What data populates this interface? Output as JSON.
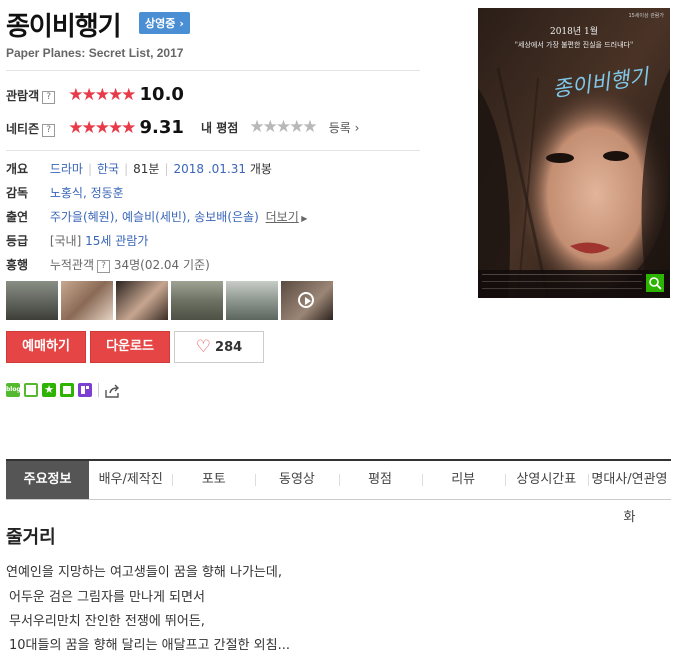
{
  "movie": {
    "title": "종이비행기",
    "status_badge": "상영중",
    "subtitle": "Paper Planes: Secret List, 2017"
  },
  "ratings": {
    "audience_label": "관람객",
    "audience_score": "10.0",
    "audience_stars": "★★★★★",
    "netizen_label": "네티즌",
    "netizen_score": "9.31",
    "netizen_stars": "★★★★★",
    "my_rating_label": "내 평점",
    "my_rating_stars": "★★★★★",
    "register_label": "등록"
  },
  "info": {
    "overview_label": "개요",
    "genre": "드라마",
    "country": "한국",
    "runtime": "81분",
    "release_date": "2018 .01.31",
    "release_suffix": "개봉",
    "director_label": "감독",
    "directors": "노홍식, 정동훈",
    "cast_label": "출연",
    "cast": "주가을(혜원), 예슬비(세빈), 송보배(은솔)",
    "more_label": "더보기",
    "grade_label": "등급",
    "grade_prefix": "[국내]",
    "grade": "15세 관람가",
    "boxoffice_label": "흥행",
    "boxoffice_prefix": "누적관객",
    "boxoffice_value": "34명(02.04 기준)"
  },
  "buttons": {
    "reserve": "예매하기",
    "download": "다운로드",
    "like_count": "284"
  },
  "poster": {
    "date_text": "2018년 1월",
    "tagline": "\"세상에서 가장 불편한 진실을 드러내다\"",
    "title_text": "종이비행기",
    "rating_text": "15세이상 관람가"
  },
  "tabs": [
    "주요정보",
    "배우/제작진",
    "포토",
    "동영상",
    "평점",
    "리뷰",
    "상영시간표",
    "명대사/연관영화"
  ],
  "synopsis": {
    "title": "줄거리",
    "lines": [
      "연예인을 지망하는 여고생들이 꿈을 향해 나가는데,",
      "어두운 검은 그림자를 만나게 되면서",
      "무서우리만치 잔인한 전쟁에 뛰어든,",
      "10대들의 꿈을 향해 달리는 애달프고 간절한 외침..."
    ]
  },
  "colors": {
    "accent_red": "#e64545",
    "badge_blue": "#4a8fd4",
    "link_blue": "#3a66b8"
  }
}
